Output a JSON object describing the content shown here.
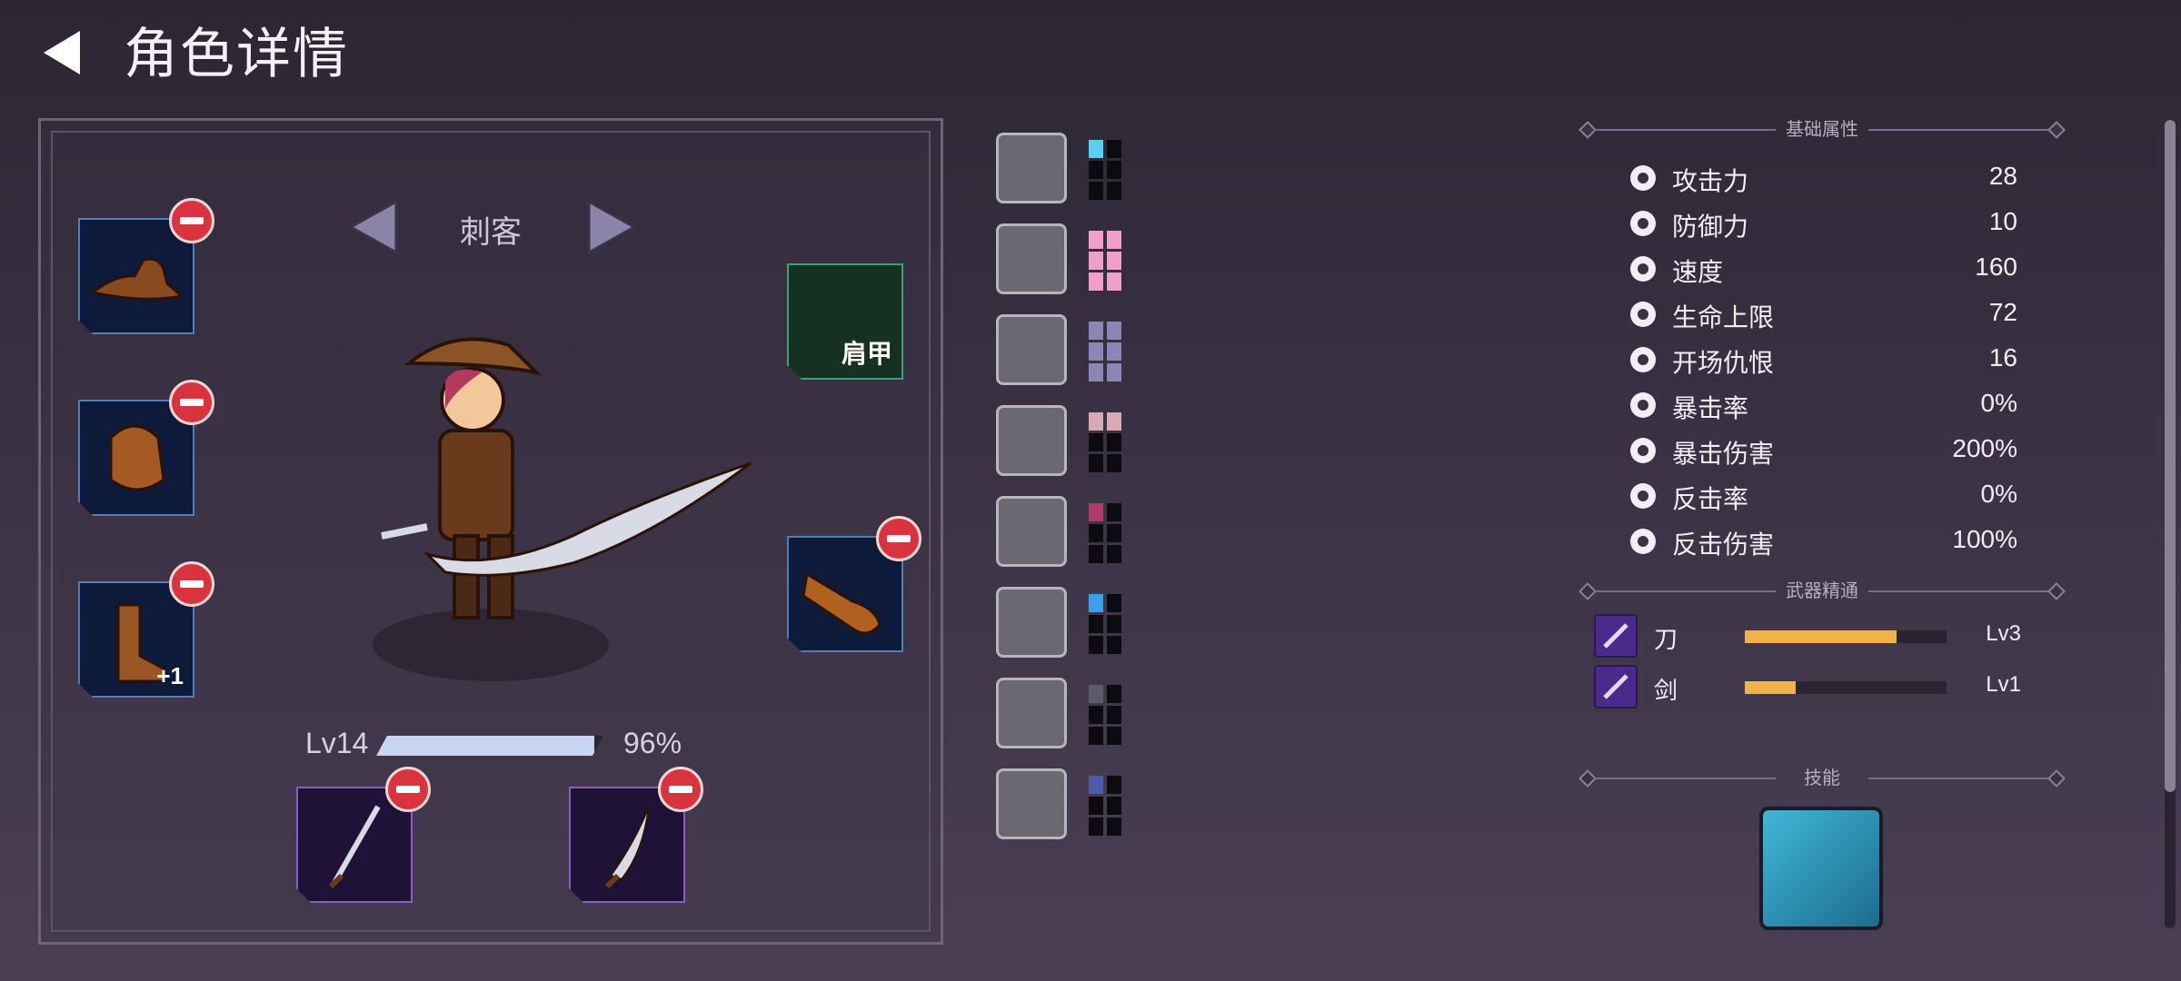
{
  "header": {
    "title": "角色详情"
  },
  "character": {
    "class_name": "刺客",
    "level_label": "Lv14",
    "level_progress": 0.96,
    "level_percent": "96%",
    "equipment_left": [
      {
        "slot": "hat",
        "badge": ""
      },
      {
        "slot": "armor",
        "badge": ""
      },
      {
        "slot": "boots",
        "badge": "+1"
      }
    ],
    "shoulder_slot_label": "肩甲",
    "gloves_slot": {
      "slot": "gloves"
    },
    "weapons": [
      {
        "name": "sword"
      },
      {
        "name": "dagger"
      }
    ]
  },
  "runes": [
    {
      "pips": 6,
      "filled": 1,
      "color": "#5ad0f0"
    },
    {
      "pips": 6,
      "filled": 6,
      "color": "#f0a0c8"
    },
    {
      "pips": 6,
      "filled": 6,
      "color": "#8c86b4"
    },
    {
      "pips": 6,
      "filled": 2,
      "color": "#d8a8b4"
    },
    {
      "pips": 6,
      "filled": 1,
      "color": "#b03a6a"
    },
    {
      "pips": 6,
      "filled": 1,
      "color": "#3aa0e8"
    },
    {
      "pips": 6,
      "filled": 1,
      "color": "#5a5c6a"
    },
    {
      "pips": 6,
      "filled": 1,
      "color": "#4a5ca8"
    }
  ],
  "stats": {
    "section_title": "基础属性",
    "rows": [
      {
        "icon": "sword-icon",
        "label": "攻击力",
        "value": "28"
      },
      {
        "icon": "shield-icon",
        "label": "防御力",
        "value": "10"
      },
      {
        "icon": "boot-icon",
        "label": "速度",
        "value": "160"
      },
      {
        "icon": "heart-icon",
        "label": "生命上限",
        "value": "72"
      },
      {
        "icon": "skull-icon",
        "label": "开场仇恨",
        "value": "16"
      },
      {
        "icon": "crit-icon",
        "label": "暴击率",
        "value": "0%"
      },
      {
        "icon": "crossed-swords-icon",
        "label": "暴击伤害",
        "value": "200%"
      },
      {
        "icon": "counter-icon",
        "label": "反击率",
        "value": "0%"
      },
      {
        "icon": "counter-damage-icon",
        "label": "反击伤害",
        "value": "100%"
      }
    ]
  },
  "mastery": {
    "section_title": "武器精通",
    "rows": [
      {
        "label": "刀",
        "level": "Lv3",
        "progress": 0.75
      },
      {
        "label": "剑",
        "level": "Lv1",
        "progress": 0.25
      }
    ]
  },
  "skills": {
    "section_title": "技能"
  }
}
